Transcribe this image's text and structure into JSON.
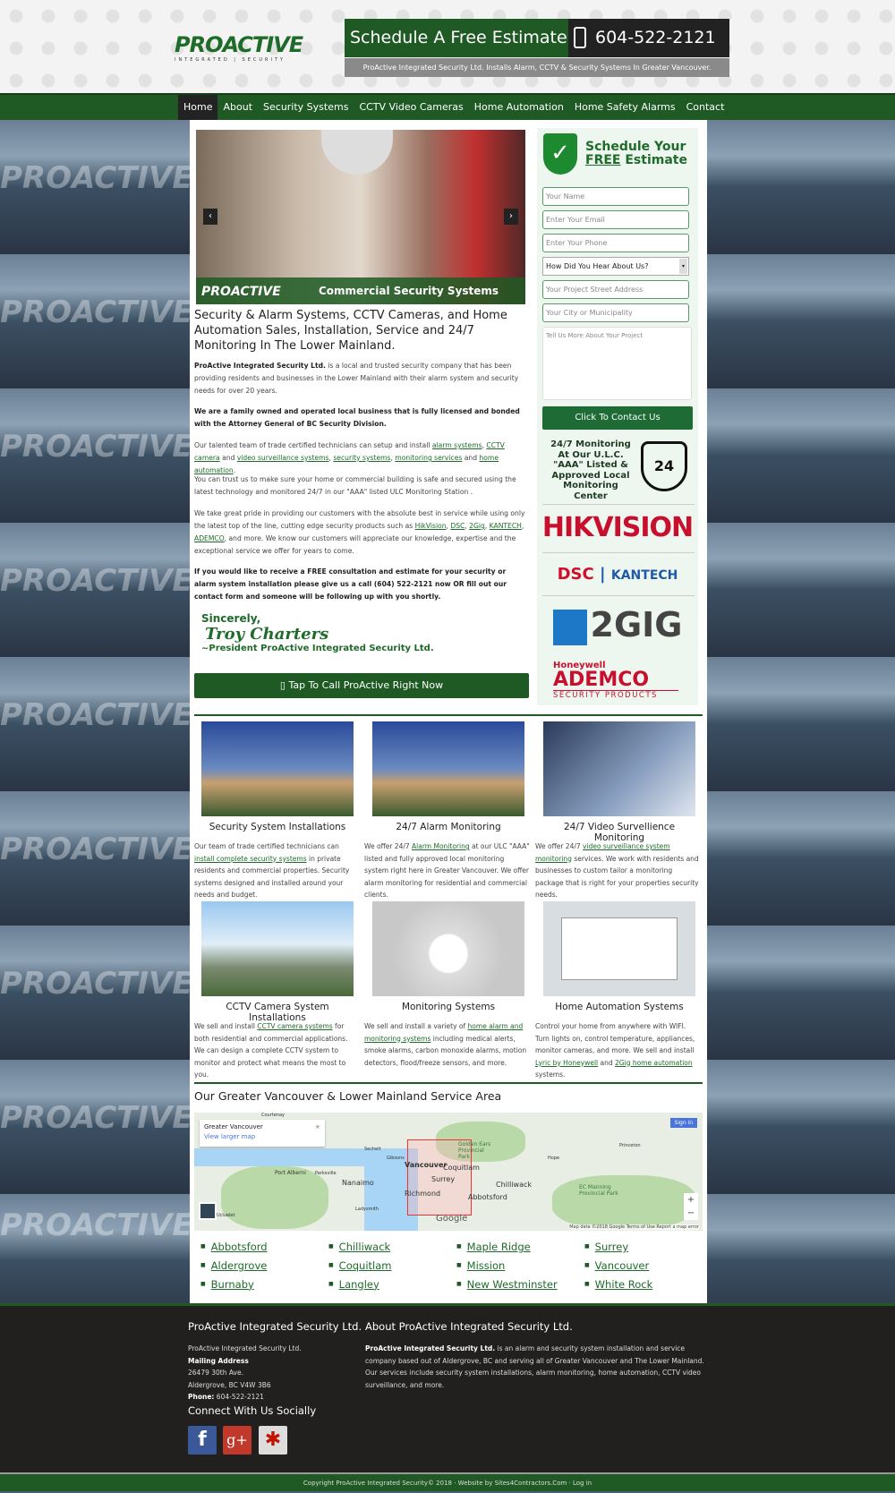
{
  "header": {
    "logo_text": "PROACTIVE",
    "logo_sub": "INTEGRATED | SECURITY",
    "schedule": "Schedule A Free Estimate",
    "phone": "604-522-2121",
    "tagline": "ProActive Integrated Security Ltd. Installs Alarm, CCTV & Security Systems In Greater Vancouver."
  },
  "nav": {
    "items": [
      "Home",
      "About",
      "Security Systems",
      "CCTV Video Cameras",
      "Home Automation",
      "Home Safety Alarms",
      "Contact"
    ],
    "active": "Home"
  },
  "slider": {
    "caption": "Commercial Security Systems",
    "logo": "PROACTIVE",
    "prev": "‹",
    "next": "›"
  },
  "main": {
    "heading": "Security & Alarm Systems, CCTV Cameras, and Home Automation Sales, Installation, Service and 24/7 Monitoring In The Lower Mainland.",
    "p1_bold": "ProActive Integrated Security Ltd.",
    "p1": " is a local and trusted security company that has been providing residents and businesses in the Lower Mainland with their alarm system and security needs for over 20 years.",
    "p2": "We are a family owned and operated local business that is fully licensed and bonded with the Attorney General of BC Security Division.",
    "p3_pre": "Our talented team of trade certified technicians can setup and install ",
    "p3_links": [
      "alarm systems",
      "CCTV camera",
      "video surveillance systems",
      "security systems",
      "monitoring services",
      "home automation"
    ],
    "p3_and1": " and ",
    "p3_and2": " and ",
    "p4": "You can trust us to make sure your home or commercial building is safe and secured using the latest technology and monitored 24/7 in our \"AAA\" listed ULC Monitoring Station .",
    "p5_pre": "We take great pride in providing our customers with the absolute best in service while using only the latest top of the line, cutting edge security products such as ",
    "p5_links": [
      "HikVision",
      "DSC",
      "2Gig",
      "KANTECH",
      "ADEMCO"
    ],
    "p5_post": ", and more.  We know our customers will appreciate our knowledge, expertise and the exceptional service we offer for years to come.",
    "p6": "If you would like to receive a FREE consultation and estimate for your security or alarm system installation please give us a call (604) 522-2121 now OR fill out our contact form and someone will be following up with you shortly.",
    "sig1": "Sincerely,",
    "sig2": "Troy Charters",
    "sig3": "~President ProActive Integrated Security Ltd.",
    "call_button": "Tap To Call ProActive Right Now"
  },
  "form": {
    "title1": "Schedule Your",
    "title2a": "FREE",
    "title2b": " Estimate",
    "name": "Your Name",
    "email": "Enter Your Email",
    "phone": "Enter Your Phone",
    "hear": "How Did You Hear About Us?",
    "address": "Your Project Street Address",
    "city": "Your City or Municipality",
    "message": "Tell Us More About Your Project",
    "submit": "Click To Contact Us"
  },
  "monitoring": {
    "text": "24/7 Monitoring At Our U.L.C. \"AAA\" Listed & Approved Local Monitoring Center",
    "badge": "24"
  },
  "brands": {
    "hik": "HIKVISION",
    "dsc": "DSC",
    "kantech": "KANTECH",
    "gig": "2GIG",
    "honeywell": "Honeywell",
    "ademco": "ADEMCO",
    "ademco_sub": "SECURITY PRODUCTS"
  },
  "services": [
    {
      "title": "Security System Installations",
      "pre": "Our team of trade certified technicians can ",
      "link": "install complete security systems",
      "post": " in private residents and commercial properties.  Security systems designed and installed around your needs and budget."
    },
    {
      "title": "24/7 Alarm Monitoring",
      "pre": "We offer 24/7 ",
      "link": "Alarm Monitoring",
      "post": " at our ULC \"AAA\" listed and fully approved local monitoring system right here in Greater Vancouver.  We offer alarm monitoring for residential and commercial clients."
    },
    {
      "title": "24/7 Video Survellience Monitoring",
      "pre": "We offer 24/7 ",
      "link": "video surveillance system monitoring",
      "post": " services.  We work with residents and businesses to custom tailor a monitoring package that is right for your properties security needs."
    },
    {
      "title": "CCTV Camera System Installations",
      "pre": "We sell and install ",
      "link": "CCTV camera systems",
      "post": " for both residential and commercial applications.  We can design a complete CCTV system to monitor and protect what means the most to you."
    },
    {
      "title": "Monitoring Systems",
      "pre": "We sell and install a variety of ",
      "link": "home alarm and monitoring systems",
      "post": " including medical alerts, smoke alarms, carbon monoxide alarms, motion detectors, flood/freeze sensors, and more."
    },
    {
      "title": "Home Automation Systems",
      "pre": "Control your home from anywhere with WIFI.  Turn lights on, control temperature, appliances, monitor cameras, and more.  We sell and install ",
      "link": "Lyric by Honeywell",
      "mid": " and ",
      "link2": "2Gig home automation",
      "post": " systems."
    }
  ],
  "map": {
    "heading": "Our Greater Vancouver & Lower Mainland Service Area",
    "box_title": "Greater Vancouver",
    "box_link": "View larger map",
    "signin": "Sign in",
    "labels": [
      "Vancouver",
      "Coquitlam",
      "Surrey",
      "Richmond",
      "Abbotsford",
      "Nanaimo",
      "Chilliwack",
      "Port Alberni",
      "Golden Ears Provincial Park",
      "EC Manning Provincial Park",
      "Hope",
      "Courtenay",
      "Parksville",
      "Gibsons",
      "Sechelt",
      "Ladysmith",
      "Ucluelet",
      "Princeton"
    ],
    "attribution": "Map data ©2018 Google   Terms of Use   Report a map error",
    "google": "Google"
  },
  "cities": [
    [
      "Abbotsford",
      "Aldergrove",
      "Burnaby"
    ],
    [
      "Chilliwack",
      "Coquitlam",
      "Langley"
    ],
    [
      "Maple Ridge",
      "Mission",
      "New Westminster"
    ],
    [
      "Surrey",
      "Vancouver",
      "White Rock"
    ]
  ],
  "footer": {
    "h1": "ProActive Integrated Security Ltd.",
    "company": "ProActive Integrated Security Ltd.",
    "mailing": "Mailing Address",
    "street": "26479 30th Ave.",
    "cityline": "Aldergrove, BC V4W 3B6",
    "phone_label": "Phone:",
    "phone": " 604-522-2121",
    "social": "Connect With Us Socially",
    "h2": "About ProActive Integrated Security Ltd.",
    "about_bold": "ProActive Integrated Security Ltd.",
    "about": " is an alarm and security system installation and service company based out of Aldergrove, BC and serving all of Greater Vancouver and The Lower Mainland.  Our services include security system installations, alarm monitoring, home automation, CCTV video surveillance, and more.",
    "copyright": "Copyright ProActive Integrated Security© 2018 · Website by Sites4Contractors.Com · Log in"
  },
  "colors": {
    "brand_green": "#1f5a25",
    "footer_bg": "#221f1f"
  }
}
